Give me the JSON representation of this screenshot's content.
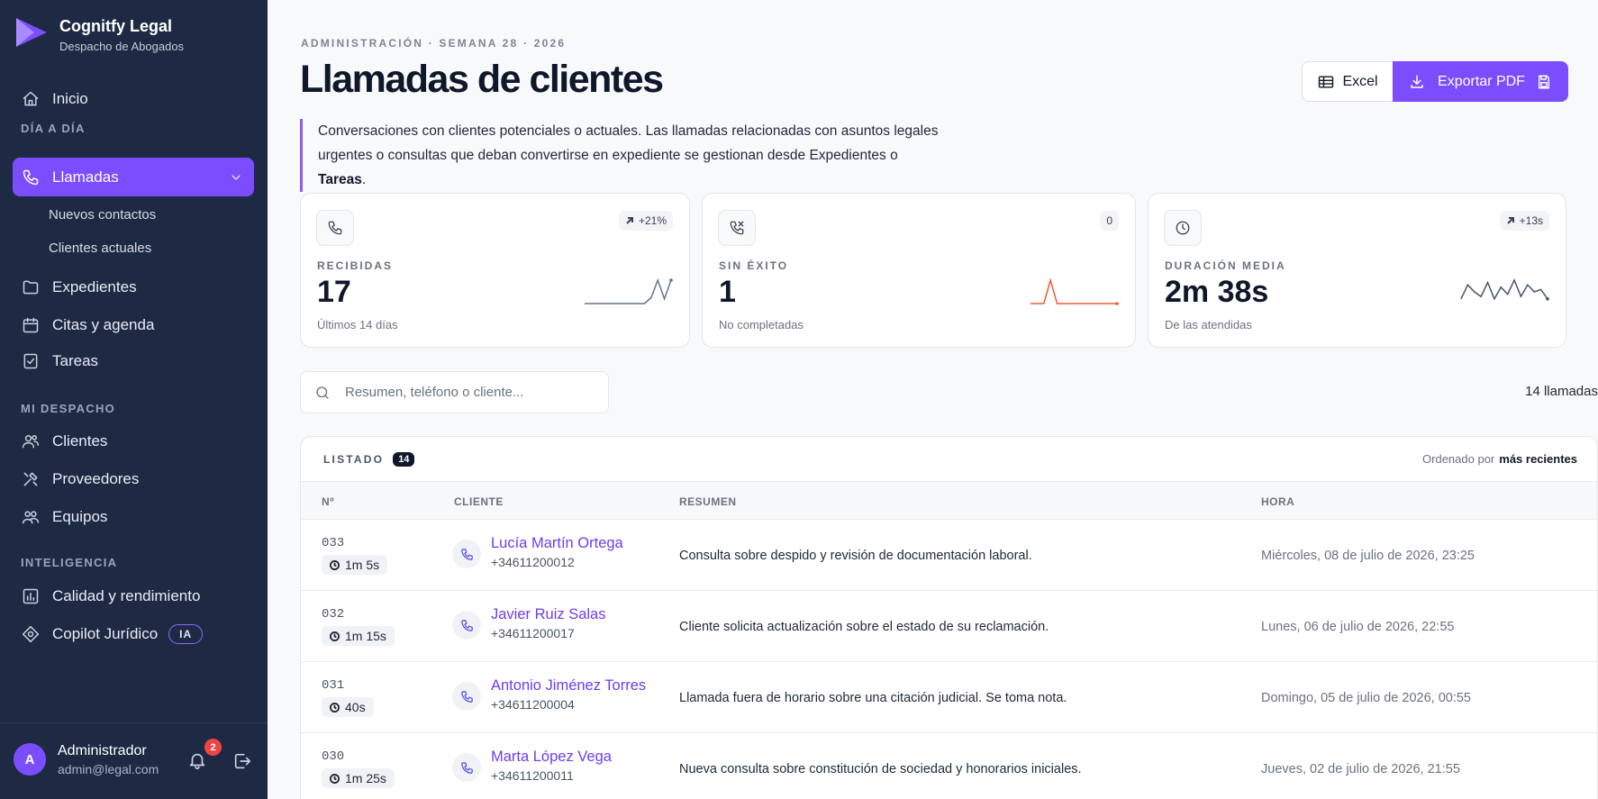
{
  "brand": {
    "title": "Cognitfy Legal",
    "subtitle": "Despacho de Abogados"
  },
  "colors": {
    "sidebar": "#1e2a44",
    "accent": "#7c4dff",
    "danger": "#ef4444"
  },
  "nav": {
    "inicio": "Inicio",
    "section_dia": "DÍA A DÍA",
    "llamadas": "Llamadas",
    "nuevos": "Nuevos contactos",
    "actuales": "Clientes actuales",
    "expedientes": "Expedientes",
    "citas": "Citas y agenda",
    "tareas": "Tareas",
    "section_despacho": "MI DESPACHO",
    "clientes": "Clientes",
    "proveedores": "Proveedores",
    "equipos": "Equipos",
    "section_intel": "INTELIGENCIA",
    "calidad": "Calidad y rendimiento",
    "copilot": "Copilot Jurídico",
    "ia_badge": "IA"
  },
  "user": {
    "initial": "A",
    "name": "Administrador",
    "email": "admin@legal.com",
    "notifications": "2"
  },
  "header": {
    "eyebrow": "ADMINISTRACIÓN · SEMANA 28 · 2026",
    "title": "Llamadas de clientes",
    "intro_a": "Conversaciones con clientes potenciales o actuales. Las llamadas relacionadas con asuntos legales urgentes o consultas que deban convertirse en expediente se gestionan desde Expedientes o ",
    "intro_b": "Tareas",
    "intro_c": ".",
    "excel_label": "Excel",
    "pdf_label": "Exportar PDF"
  },
  "kpis": [
    {
      "label": "RECIBIDAS",
      "value": "17",
      "sub": "Últimos 14 días",
      "delta": "+21%",
      "trend": [
        0,
        0,
        0,
        0,
        0,
        0,
        0,
        0,
        0,
        0,
        0.25,
        1,
        0.2,
        1
      ],
      "color": "#64748b"
    },
    {
      "label": "SIN ÉXITO",
      "value": "1",
      "sub": "No completadas",
      "delta": "0",
      "trend": [
        0,
        0,
        0,
        1,
        0,
        0,
        0,
        0,
        0,
        0,
        0,
        0,
        0,
        0
      ],
      "color": "#ef5a3c"
    },
    {
      "label": "DURACIÓN MEDIA",
      "value": "2m 38s",
      "sub": "De las atendidas",
      "delta": "+13s",
      "trend": [
        0.2,
        0.8,
        0.5,
        0.3,
        0.9,
        0.2,
        0.7,
        0.4,
        1,
        0.3,
        0.8,
        0.5,
        0.6,
        0.2
      ],
      "color": "#475569"
    }
  ],
  "search": {
    "placeholder": "Resumen, teléfono o cliente..."
  },
  "count_label": "14 llamadas",
  "table": {
    "title": "LISTADO",
    "count": "14",
    "sort_prefix": "Ordenado por",
    "sort_value": "más recientes",
    "columns": {
      "num": "Nº",
      "cliente": "CLIENTE",
      "resumen": "RESUMEN",
      "hora": "HORA"
    },
    "rows": [
      {
        "num": "033",
        "dur": "1m 5s",
        "name": "Lucía Martín Ortega",
        "tel": "+34611200012",
        "summary": "Consulta sobre despido y revisión de documentación laboral.",
        "time": "Miércoles, 08 de julio de 2026, 23:25"
      },
      {
        "num": "032",
        "dur": "1m 15s",
        "name": "Javier Ruiz Salas",
        "tel": "+34611200017",
        "summary": "Cliente solicita actualización sobre el estado de su reclamación.",
        "time": "Lunes, 06 de julio de 2026, 22:55"
      },
      {
        "num": "031",
        "dur": "40s",
        "name": "Antonio Jiménez Torres",
        "tel": "+34611200004",
        "summary": "Llamada fuera de horario sobre una citación judicial. Se toma nota.",
        "time": "Domingo, 05 de julio de 2026, 00:55"
      },
      {
        "num": "030",
        "dur": "1m 25s",
        "name": "Marta López Vega",
        "tel": "+34611200011",
        "summary": "Nueva consulta sobre constitución de sociedad y honorarios iniciales.",
        "time": "Jueves, 02 de julio de 2026, 21:55"
      }
    ]
  }
}
